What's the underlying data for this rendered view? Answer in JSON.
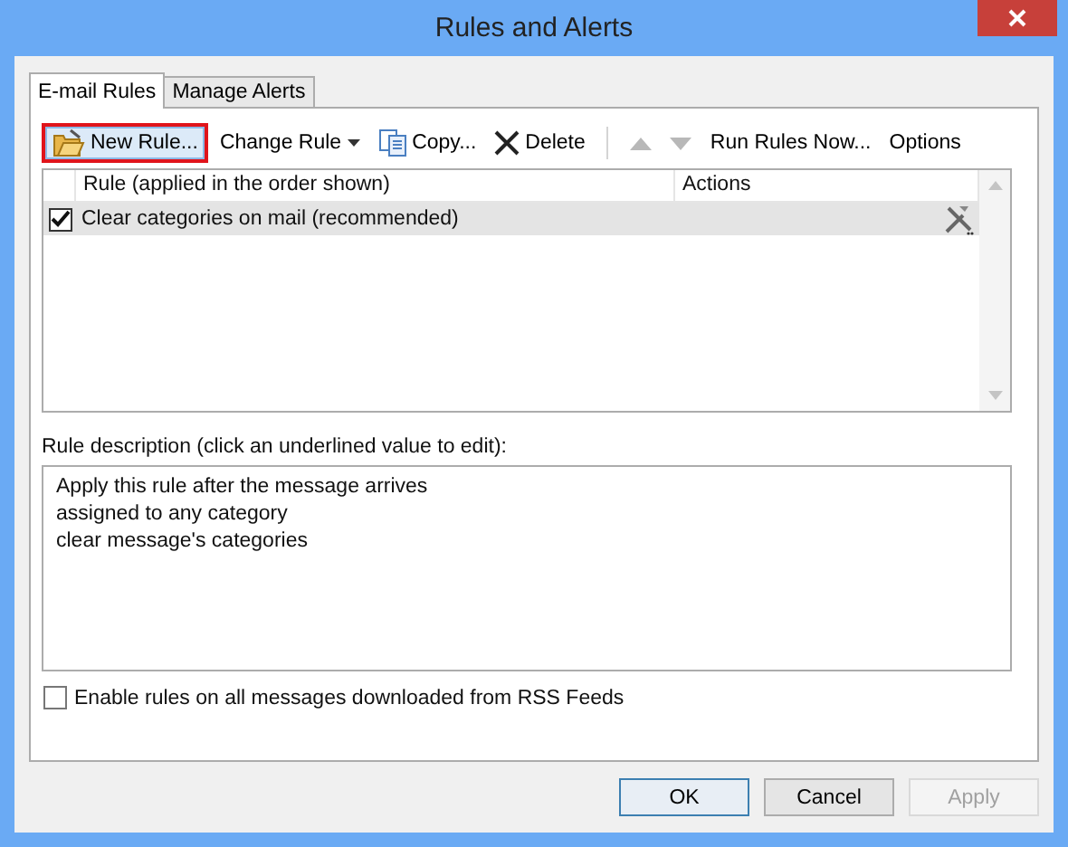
{
  "window": {
    "title": "Rules and Alerts"
  },
  "tabs": [
    {
      "label": "E-mail Rules",
      "selected": true
    },
    {
      "label": "Manage Alerts",
      "selected": false
    }
  ],
  "toolbar": [
    {
      "kind": "new",
      "label": "New Rule...",
      "highlighted": true
    },
    {
      "kind": "dropdown",
      "label": "Change Rule",
      "highlighted": false
    },
    {
      "kind": "copy",
      "label": "Copy...",
      "highlighted": false
    },
    {
      "kind": "delete",
      "label": "Delete",
      "highlighted": false
    },
    {
      "kind": "separator"
    },
    {
      "kind": "up",
      "disabled": true
    },
    {
      "kind": "down",
      "disabled": true
    },
    {
      "kind": "button",
      "label": "Run Rules Now...",
      "highlighted": false
    },
    {
      "kind": "button",
      "label": "Options",
      "highlighted": false
    }
  ],
  "rules_table": {
    "columns": [
      "Rule (applied in the order shown)",
      "Actions"
    ],
    "rows": [
      {
        "name": "Clear categories on mail (recommended)",
        "checked": true,
        "selected": true
      }
    ]
  },
  "description": {
    "label": "Rule description (click an underlined value to edit):",
    "lines": [
      "Apply this rule after the message arrives",
      "assigned to any category",
      "clear message's categories"
    ]
  },
  "rss_option": {
    "label": "Enable rules on all messages downloaded from RSS Feeds",
    "checked": false
  },
  "buttons": [
    {
      "label": "OK",
      "default": true,
      "disabled": false
    },
    {
      "label": "Cancel",
      "default": false,
      "disabled": false
    },
    {
      "label": "Apply",
      "default": false,
      "disabled": true
    }
  ]
}
